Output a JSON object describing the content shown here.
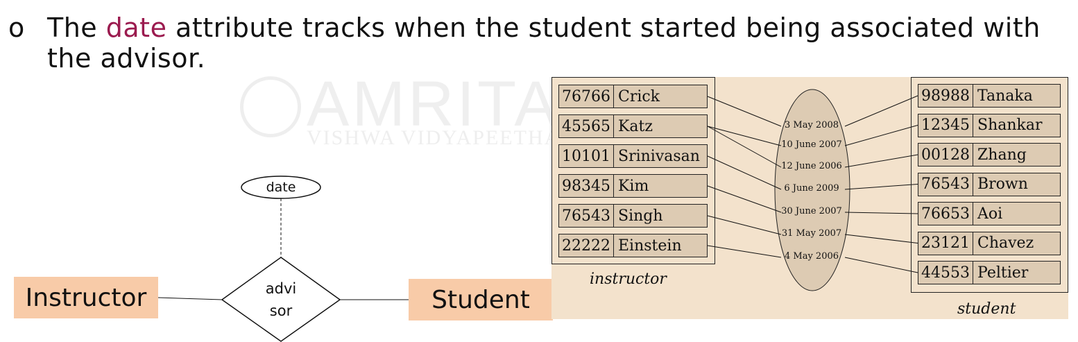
{
  "bullet": {
    "marker": "o",
    "text_before": "The ",
    "highlight": "date",
    "text_after": " attribute tracks when the student started being associated with the advisor."
  },
  "watermark": {
    "title": "AMRITA",
    "subtitle": "VISHWA VIDYAPEETHAM"
  },
  "er_diagram": {
    "entity_left": "Instructor",
    "entity_right": "Student",
    "relationship_line1": "advi",
    "relationship_line2": "sor",
    "attribute": "date"
  },
  "instance": {
    "instructor_caption": "instructor",
    "student_caption": "student",
    "instructors": [
      {
        "id": "76766",
        "name": "Crick"
      },
      {
        "id": "45565",
        "name": "Katz"
      },
      {
        "id": "10101",
        "name": "Srinivasan"
      },
      {
        "id": "98345",
        "name": "Kim"
      },
      {
        "id": "76543",
        "name": "Singh"
      },
      {
        "id": "22222",
        "name": "Einstein"
      }
    ],
    "students": [
      {
        "id": "98988",
        "name": "Tanaka"
      },
      {
        "id": "12345",
        "name": "Shankar"
      },
      {
        "id": "00128",
        "name": "Zhang"
      },
      {
        "id": "76543",
        "name": "Brown"
      },
      {
        "id": "76653",
        "name": "Aoi"
      },
      {
        "id": "23121",
        "name": "Chavez"
      },
      {
        "id": "44553",
        "name": "Peltier"
      }
    ],
    "dates": [
      "3 May 2008",
      "10 June 2007",
      "12 June 2006",
      "6 June 2009",
      "30 June 2007",
      "31 May 2007",
      "4 May 2006"
    ],
    "links": [
      {
        "instructor": 0,
        "date": 0,
        "student": 0
      },
      {
        "instructor": 1,
        "date": 1,
        "student": 1
      },
      {
        "instructor": 1,
        "date": 2,
        "student": 2
      },
      {
        "instructor": 2,
        "date": 3,
        "student": 3
      },
      {
        "instructor": 3,
        "date": 4,
        "student": 4
      },
      {
        "instructor": 4,
        "date": 5,
        "student": 5
      },
      {
        "instructor": 5,
        "date": 6,
        "student": 6
      }
    ]
  },
  "colors": {
    "highlight": "#9b1b4f",
    "entity_fill": "#f8cba8",
    "panel_bg": "#f3e2cc",
    "row_fill": "#ddcbb3"
  }
}
